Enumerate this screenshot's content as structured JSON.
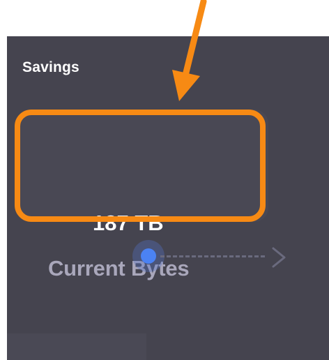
{
  "panel": {
    "title": "Savings"
  },
  "stat": {
    "value": "187 TB",
    "label": "Current Bytes"
  },
  "colors": {
    "panel_background": "#45444f",
    "title_text": "#ffffff",
    "value_text": "#ffffff",
    "label_text": "#a9a7bb",
    "highlight": "#f78a14",
    "flow_dot": "#4b82f3",
    "flow_line": "#6a6a7e"
  },
  "icons": {
    "flow_start": "dot-icon",
    "flow_end": "chevron-right-icon",
    "annotation": "arrow-down-icon"
  }
}
